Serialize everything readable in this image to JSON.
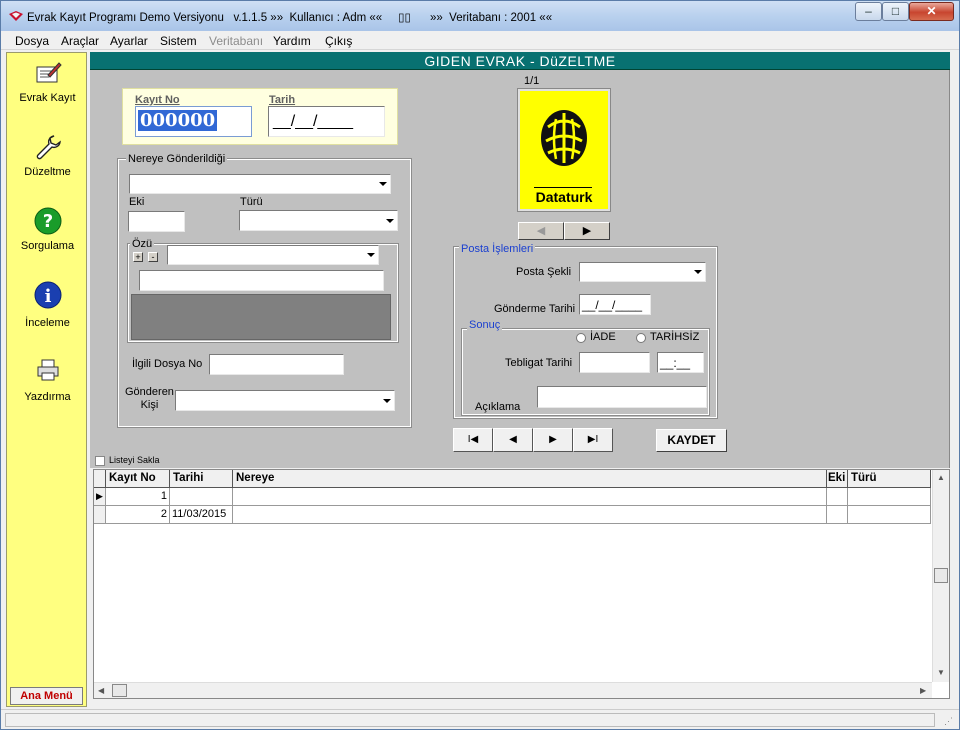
{
  "window": {
    "title": "Evrak Kayıt Programı Demo Versiyonu   v.1.1.5 »»  Kullanıcı : Adm ««     ▯▯      »»  Veritabanı : 2001 ««",
    "min": "–",
    "max": "□",
    "close": "✕"
  },
  "menu": {
    "items": [
      {
        "label": "Dosya"
      },
      {
        "label": "Araçlar"
      },
      {
        "label": "Ayarlar"
      },
      {
        "label": "Sistem"
      },
      {
        "label": "Veritabanı"
      },
      {
        "label": "Yardım"
      },
      {
        "label": "Çıkış"
      }
    ]
  },
  "sidebar": {
    "items": [
      {
        "label": "Evrak Kayıt",
        "icon": "document-edit-icon"
      },
      {
        "label": "Düzeltme",
        "icon": "wrench-icon"
      },
      {
        "label": "Sorgulama",
        "icon": "question-icon"
      },
      {
        "label": "İnceleme",
        "icon": "info-icon"
      },
      {
        "label": "Yazdırma",
        "icon": "printer-icon"
      }
    ],
    "main_menu": "Ana Menü"
  },
  "form": {
    "heading": "GIDEN EVRAK - DüZELTME",
    "kayit_no_label": "Kayıt No",
    "kayit_no_value": "000000",
    "tarih_label": "Tarih",
    "tarih_value": "__/__/____",
    "nereye_label": "Nereye Gönderildiği",
    "eki_label": "Eki",
    "turu_label": "Türü",
    "ozu_label": "Özü",
    "plus": "+",
    "minus": "-",
    "ilgili_label": "İlgili  Dosya No",
    "gonderen_label": "Gönderen\nKişi",
    "image_counter": "1/1",
    "logo_text": "Dataturk",
    "posta_label": "Posta İşlemleri",
    "posta_sekli_label": "Posta Şekli",
    "gonderme_label": "Gönderme Tarihi",
    "gonderme_value": "__/__/____",
    "sonuc_label": "Sonuç",
    "iade_label": "İADE",
    "tarihsiz_label": "TARİHSİZ",
    "tebligat_label": "Tebligat Tarihi",
    "tebligat_time": "__:__",
    "aciklama_label": "Açıklama",
    "save_label": "KAYDET",
    "nav_first": "I◀",
    "nav_prev": "◀",
    "nav_next": "▶",
    "nav_last": "▶I",
    "img_prev": "◀",
    "img_next": "▶"
  },
  "list": {
    "keep_label": "Listeyi Sakla",
    "columns": [
      "Kayıt No",
      "Tarihi",
      "Nereye",
      "Eki",
      "Türü"
    ],
    "rows": [
      {
        "no": "1",
        "tarih": ""
      },
      {
        "no": "2",
        "tarih": "11/03/2015"
      }
    ]
  },
  "colors": {
    "sidebar": "#ffff80",
    "header": "#087171",
    "accent_red": "#c00000"
  }
}
